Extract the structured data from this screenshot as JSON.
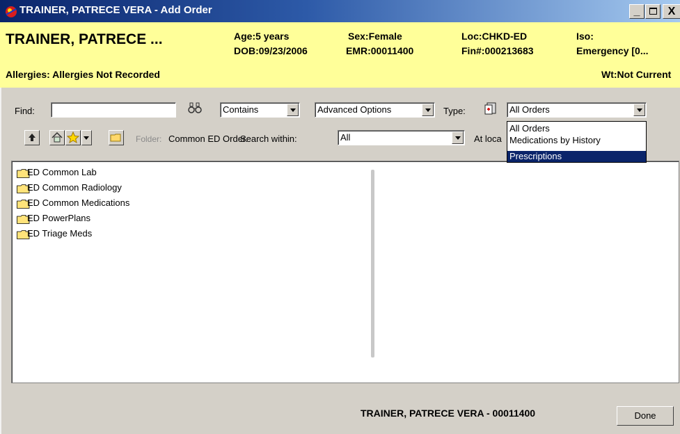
{
  "window": {
    "title": "TRAINER, PATRECE VERA - Add Order",
    "minimize_label": "_",
    "maximize_label": "□",
    "close_label": "X"
  },
  "banner": {
    "patient_name": "TRAINER, PATRECE ...",
    "age": "Age:5 years",
    "sex": "Sex:Female",
    "location": "Loc:CHKD-ED",
    "iso": "Iso:",
    "dob": "DOB:09/23/2006",
    "emr": "EMR:00011400",
    "fin": "Fin#:000213683",
    "encounter": "Emergency [0...",
    "allergies": "Allergies: Allergies Not Recorded",
    "weight": "Wt:Not Current"
  },
  "search": {
    "find_label": "Find:",
    "find_value": "",
    "match_mode": "Contains",
    "advanced_options": "Advanced Options",
    "type_label": "Type:",
    "type_value": "All Orders",
    "type_options": [
      "All Orders",
      "Medications by History",
      "Prescriptions"
    ],
    "type_selected_index": 2
  },
  "folder_bar": {
    "folder_label": "Folder:",
    "folder_name": "Common ED Order.",
    "search_within_label": "Search within:",
    "search_within_value": "All",
    "at_location_label": "At loca"
  },
  "tree": {
    "items": [
      {
        "label": "ED Common Lab"
      },
      {
        "label": "ED Common Radiology"
      },
      {
        "label": "ED Common Medications"
      },
      {
        "label": "ED PowerPlans"
      },
      {
        "label": "ED Triage Meds"
      }
    ]
  },
  "footer": {
    "patient_summary": "TRAINER, PATRECE VERA - 00011400",
    "done_label": "Done"
  },
  "colors": {
    "banner_bg": "#ffff99",
    "title_bar": "#0a246a",
    "selection": "#0a246a",
    "folder": "#ffd86a"
  }
}
